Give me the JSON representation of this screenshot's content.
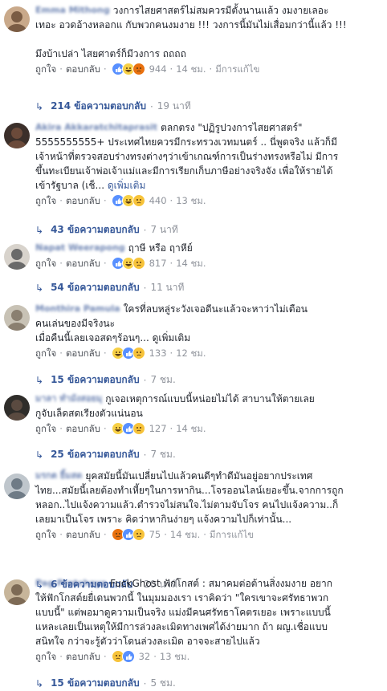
{
  "actions": {
    "like": "ถูกใจ",
    "reply": "ตอบกลับ",
    "edited": "มีการแก้ไข",
    "dot": "·"
  },
  "comments": [
    {
      "name": "Emma Mithong",
      "lines": [
        "วงการไสยศาสตร์ไม่สมควรมีตั้งนานแล้ว งมงายเลอะ",
        "เทอะ อวดอ้างหลอกแ    กับพวกคนงมงาย !!! วงการนี้มันไม่เสื่อมกว่านี้แล้ว !!!",
        "",
        "มึงบ้าเปล่า ไสยศาตร์ก็มีวงการ ถถถถ"
      ],
      "reactions": [
        "like",
        "haha",
        "angry"
      ],
      "count": "944",
      "time": "14 ชม.",
      "edited": true,
      "replies_label": "214 ข้อความตอบกลับ",
      "replies_time": "19 นาที"
    },
    {
      "name": "Akira Akkaratchitaprasit",
      "lines": [
        "ตลกตรง \"ปฏิรูปวงการไสยศาสตร์\"",
        "5555555555+ ประเทศไทยควรมีกระทรวงเวทมนตร์ .. นี่พูดจริง แล้วก็มี",
        "เจ้าหน้าที่ตรวจสอบร่างทรงต่างๆว่าเข้าเกณฑ์การเป็นร่างทรงหรือไม่ มีการ",
        "ขึ้นทะเบียนเจ้าพ่อเจ้าแม่และมีการเรียกเก็บภาษีอย่างจริงจัง เพื่อให้รายได้",
        "เข้ารัฐบาล (เช็..."
      ],
      "see_more": "ดูเพิ่มเติม",
      "reactions": [
        "like",
        "haha",
        "sad"
      ],
      "count": "440",
      "time": "13 ชม.",
      "edited": false,
      "replies_label": "43 ข้อความตอบกลับ",
      "replies_time": "7 นาที"
    },
    {
      "name": "Napat Weerapong",
      "lines": [
        "ฤาษี หรือ ฤาหีย์"
      ],
      "reactions": [
        "like",
        "haha",
        "sad"
      ],
      "count": "817",
      "time": "14 ชม.",
      "edited": false,
      "replies_label": "54 ข้อความตอบกลับ",
      "replies_time": "11 นาที"
    },
    {
      "name": "Monthira Pamula",
      "lines": [
        "ใครที่ลบหลู่ระวังเจอดีนะแล้วจะหาว่าไม่เตือน",
        "คนเล่นของมีจริงนะ",
        "เมื่อคืนนี้เลยเจอสดๆร้อนๆ... ดูเพิ่มเติม"
      ],
      "see_more": "",
      "reactions": [
        "haha",
        "like",
        "sad"
      ],
      "count": "133",
      "time": "12 ชม.",
      "edited": false,
      "replies_label": "15 ข้อความตอบกลับ",
      "replies_time": "7 ชม."
    },
    {
      "name": "มาลา ทำมังสอยมุ",
      "lines": [
        "กูเจอเหตุการณ์แบบนี้หน่อยไม่ได้ สาบานให้ตายเลย",
        "กูจับเล็ดสดเรียงตัวแน่นอน"
      ],
      "reactions": [
        "haha",
        "like",
        "sad"
      ],
      "count": "127",
      "time": "14 ชม.",
      "edited": false,
      "replies_label": "25 ข้อความตอบกลับ",
      "replies_time": "7 ชม."
    },
    {
      "name": "มรกต ยิ้มสด",
      "lines": [
        "ยุคสมัยนี้มันเปลี่ยนไปแล้วคนดีๆทำดีมันอยู่อยากประเทศ",
        "ไทย...สมัยนี้เลยต้องทำเหี้ยๆในการหากิน...โจรออนไลน์เยอะขึ้น.จากการถูก",
        "หลอก..ไปแจ้งความแล้ว.ตำรวจไม่สนใจ.ไม่ตามจับโจร คนไปแจ้งความ..ก็",
        "เลยมาเป็นโจร เพราะ คิดว่าหากินง่ายๆ แจ้งความไปก็เท่านั้น..."
      ],
      "reactions": [
        "angry",
        "like",
        "sad"
      ],
      "count": "75",
      "time": "14 ชม.",
      "edited": true,
      "replies_label": "6 ข้อความตอบกลับ",
      "replies_time": "20 นาที"
    },
    {
      "name": "Pag Pratchaya",
      "lines": [
        "FuckGhost ฟักโกสต์ : สมาคมต่อต้านสิ่งงมงาย อยาก",
        "ให้ฟักโกสต์ยยื่เดนพวกนี้ ในมุมมองเรา เราคิดว่า \"ใครเขาจะศรัทธาพวก",
        "แบบนี้\" แต่พอมาดูความเป็นจริง แม่งมีคนศรัทธาโคตรเยอะ เพราะแบบนี้",
        "แหละเลยเป็นเหตุให้มีการล่วงละเมิดทางเพศได้ง่ายมาก ถ้า ผญ.เชื่อแบบ",
        "สนิทใจ กว่าจะรู้ตัวว่าโดนล่วงละเมิด อาจจะสายไปแล้ว"
      ],
      "reactions": [
        "sad",
        "like"
      ],
      "count": "32",
      "time": "13 ชม.",
      "edited": false,
      "replies_label": "15 ข้อความตอบกลับ",
      "replies_time": "5 ชม."
    }
  ],
  "colors": {
    "link": "#365899",
    "meta": "#90949c",
    "name": "#4b67a1"
  }
}
